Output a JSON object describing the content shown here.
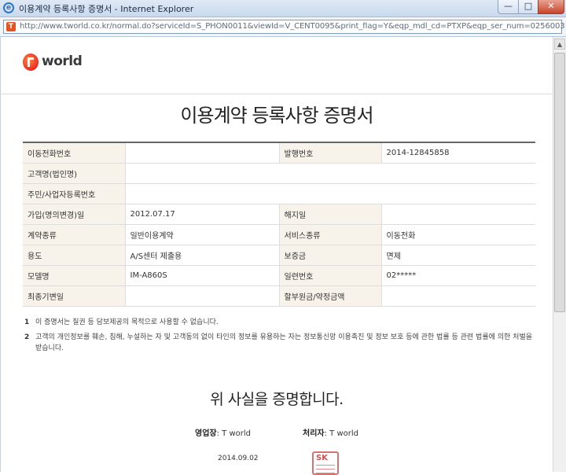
{
  "window": {
    "title": "이용계약 등록사항 증명서 - Internet Explorer",
    "minimize": "—",
    "maximize": "□",
    "close": "✕"
  },
  "address_bar": {
    "url": "http://www.tworld.co.kr/normal.do?serviceId=S_PHON0011&viewId=V_CENT0095&print_flag=Y&eqp_mdl_cd=PTXP&eqp_ser_num=0256003"
  },
  "logo": {
    "text": "world"
  },
  "document": {
    "title": "이용계약 등록사항 증명서",
    "rows": [
      {
        "label": "이동전화번호",
        "value": "",
        "label2": "발행번호",
        "value2": "2014-12845858"
      },
      {
        "label": "고객명(법인명)",
        "value": ""
      },
      {
        "label": "주민/사업자등록번호",
        "value": ""
      },
      {
        "label": "가입(명의변경)일",
        "value": "2012.07.17",
        "label2": "해지일",
        "value2": ""
      },
      {
        "label": "계약종류",
        "value": "일반이용계약",
        "label2": "서비스종류",
        "value2": "이동전화"
      },
      {
        "label": "용도",
        "value": "A/S센터 제출용",
        "label2": "보증금",
        "value2": "면제"
      },
      {
        "label": "모델명",
        "value": "IM-A860S",
        "label2": "일련번호",
        "value2": "02*****"
      },
      {
        "label": "최종기변일",
        "value": "",
        "label2": "할부원금/약정금액",
        "value2": ""
      }
    ],
    "notes": [
      {
        "num": "1",
        "text": "이 증명서는 질권 등 담보제공의 목적으로 사용할 수 없습니다."
      },
      {
        "num": "2",
        "text": "고객의 개인정보를 훼손, 침해, 누설하는 자 및 고객동의 없이 타인의 정보를 유용하는 자는 정보통신망 이용촉진 및 정보 보호 등에 관한 법률 등 관련 법률에 의한 처벌을 받습니다."
      }
    ],
    "certify": "위 사실을 증명합니다.",
    "issuer_label": "영업장",
    "issuer_value": ": T world",
    "handler_label": "처리자",
    "handler_value": ": T world",
    "date": "2014.09.02",
    "stamp_text": "SK"
  }
}
